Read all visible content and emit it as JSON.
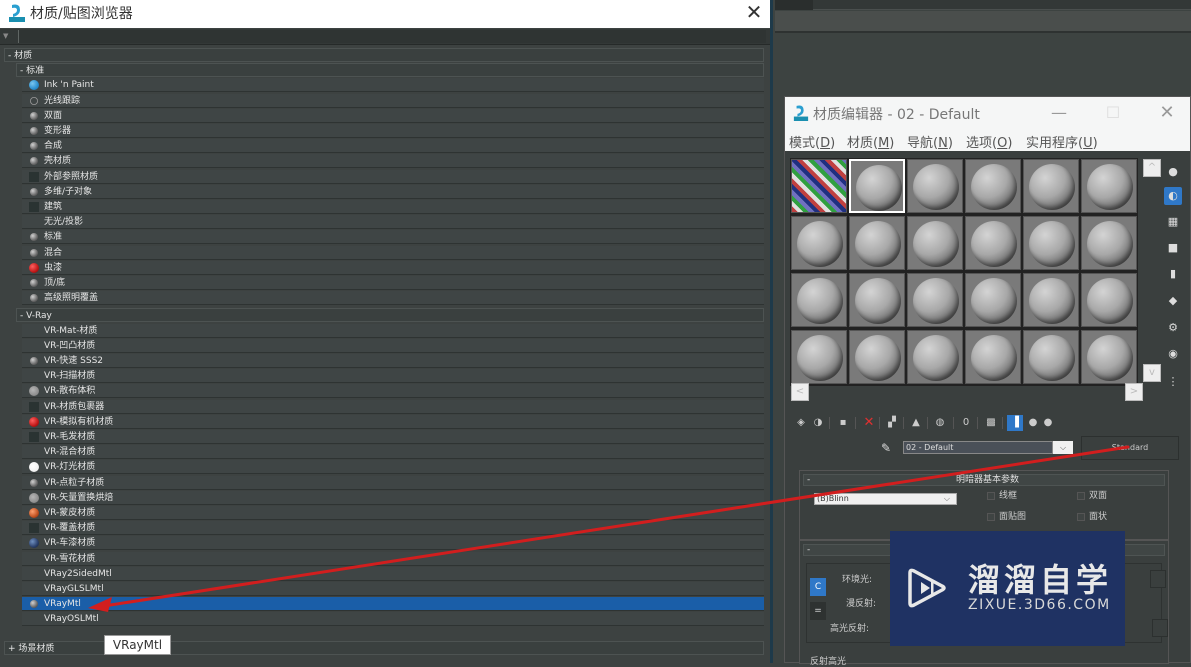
{
  "browser": {
    "title": "材质/贴图浏览器",
    "close_label": "✕",
    "search_placeholder": "",
    "search_value": "",
    "sections": [
      {
        "label": "- 材质",
        "groups": [
          {
            "label": "- 标准",
            "items": [
              {
                "label": "Ink 'n Paint",
                "icon": "sphere-blue"
              },
              {
                "label": "光线跟踪",
                "icon": "raytrace"
              },
              {
                "label": "双面",
                "icon": "sphere-grey"
              },
              {
                "label": "变形器",
                "icon": "sphere-grey"
              },
              {
                "label": "合成",
                "icon": "sphere-grey"
              },
              {
                "label": "壳材质",
                "icon": "sphere-grey"
              },
              {
                "label": "外部参照材质",
                "icon": "square-dark"
              },
              {
                "label": "多维/子对象",
                "icon": "sphere-grey"
              },
              {
                "label": "建筑",
                "icon": "square-dark"
              },
              {
                "label": "无光/投影",
                "icon": "square-none"
              },
              {
                "label": "标准",
                "icon": "sphere-grey"
              },
              {
                "label": "混合",
                "icon": "sphere-grey"
              },
              {
                "label": "虫漆",
                "icon": "sphere-red"
              },
              {
                "label": "顶/底",
                "icon": "sphere-grey"
              },
              {
                "label": "高级照明覆盖",
                "icon": "sphere-grey"
              }
            ]
          },
          {
            "label": "- V-Ray",
            "items": [
              {
                "label": "VR-Mat-材质",
                "icon": "square-none"
              },
              {
                "label": "VR-凹凸材质",
                "icon": "square-none"
              },
              {
                "label": "VR-快速 SSS2",
                "icon": "sphere-grey"
              },
              {
                "label": "VR-扫描材质",
                "icon": "square-none"
              },
              {
                "label": "VR-散布体积",
                "icon": "sphere-lightgrey"
              },
              {
                "label": "VR-材质包裹器",
                "icon": "square-dark"
              },
              {
                "label": "VR-模拟有机材质",
                "icon": "sphere-red"
              },
              {
                "label": "VR-毛发材质",
                "icon": "square-dark"
              },
              {
                "label": "VR-混合材质",
                "icon": "square-none"
              },
              {
                "label": "VR-灯光材质",
                "icon": "sphere-white"
              },
              {
                "label": "VR-点粒子材质",
                "icon": "sphere-grey"
              },
              {
                "label": "VR-矢量置换烘焙",
                "icon": "sphere-lightgrey"
              },
              {
                "label": "VR-蒙皮材质",
                "icon": "sphere-copper"
              },
              {
                "label": "VR-覆盖材质",
                "icon": "square-dark"
              },
              {
                "label": "VR-车漆材质",
                "icon": "sphere-carpaint"
              },
              {
                "label": "VR-雪花材质",
                "icon": "square-none"
              },
              {
                "label": "VRay2SidedMtl",
                "icon": "square-none"
              },
              {
                "label": "VRayGLSLMtl",
                "icon": "square-none"
              },
              {
                "label": "VRayMtl",
                "icon": "sphere-grey",
                "selected": true
              },
              {
                "label": "VRayOSLMtl",
                "icon": "square-none"
              }
            ]
          }
        ]
      },
      {
        "label": "+ 场景材质"
      }
    ],
    "tooltip": "VRayMtl"
  },
  "editor": {
    "title": "材质编辑器 - 02 - Default",
    "minimize_label": "—",
    "maximize_label": "☐",
    "close_label": "✕",
    "menu": [
      {
        "label": "模式",
        "key": "D"
      },
      {
        "label": "材质",
        "key": "M"
      },
      {
        "label": "导航",
        "key": "N"
      },
      {
        "label": "选项",
        "key": "O"
      },
      {
        "label": "实用程序",
        "key": "U"
      }
    ],
    "slots": {
      "rows": 4,
      "cols": 6,
      "active_index": 1,
      "checker_index": 0
    },
    "scroll": {
      "up": "^",
      "down": "v",
      "left": "<",
      "right": ">"
    },
    "side_toolbar": [
      {
        "name": "sample-type-icon",
        "glyph": "●"
      },
      {
        "name": "backlight-icon",
        "glyph": "◐",
        "active": true
      },
      {
        "name": "background-icon",
        "glyph": "▦"
      },
      {
        "name": "sample-uv-tiling-icon",
        "glyph": "■"
      },
      {
        "name": "video-color-check-icon",
        "glyph": "▮"
      },
      {
        "name": "make-preview-icon",
        "glyph": "◆"
      },
      {
        "name": "options-icon",
        "glyph": "⚙"
      },
      {
        "name": "select-by-material-icon",
        "glyph": "◉"
      },
      {
        "name": "material-map-navigator-icon",
        "glyph": "⋮"
      }
    ],
    "bottom_toolbar": [
      {
        "name": "get-material-icon",
        "glyph": "◈"
      },
      {
        "name": "put-to-scene-icon",
        "glyph": "◑"
      },
      {
        "name": "assign-to-selection-icon",
        "glyph": "▪"
      },
      {
        "name": "reset-map-icon",
        "glyph": "✕",
        "red": true
      },
      {
        "name": "copy-material-icon",
        "glyph": "▞"
      },
      {
        "name": "make-unique-icon",
        "glyph": "▲"
      },
      {
        "name": "put-to-library-icon",
        "glyph": "◍"
      },
      {
        "name": "material-id-channel-icon",
        "glyph": "0"
      },
      {
        "name": "show-shaded-material-icon",
        "glyph": "▩"
      },
      {
        "name": "show-end-result-icon",
        "glyph": "▐",
        "active": true
      },
      {
        "name": "go-to-parent-icon",
        "glyph": "●"
      },
      {
        "name": "go-forward-sibling-icon",
        "glyph": "●"
      }
    ],
    "material_name": "02 - Default",
    "material_type": "Standard",
    "shader_panel": {
      "collapse": "-",
      "title": "明暗器基本参数",
      "shader": "(B)Blinn",
      "checkboxes": [
        {
          "label": "线框",
          "checked": false
        },
        {
          "label": "双面",
          "checked": false
        },
        {
          "label": "面贴图",
          "checked": false
        },
        {
          "label": "面状",
          "checked": false
        }
      ]
    },
    "params_panel": {
      "collapse": "-",
      "ambient_label": "环境光:",
      "diffuse_label": "漫反射:",
      "specular_label": "高光反射:",
      "lock_label": "C",
      "lock2_label": "=",
      "spec_highlight_label": "反射高光"
    }
  },
  "watermark": {
    "brand": "溜溜自学",
    "url": "ZIXUE.3D66.COM"
  },
  "colors": {
    "selection": "#1a5ea8",
    "arrow": "#d21e1e",
    "watermark_bg": "#1f3263",
    "active_tool": "#2f78c8"
  }
}
